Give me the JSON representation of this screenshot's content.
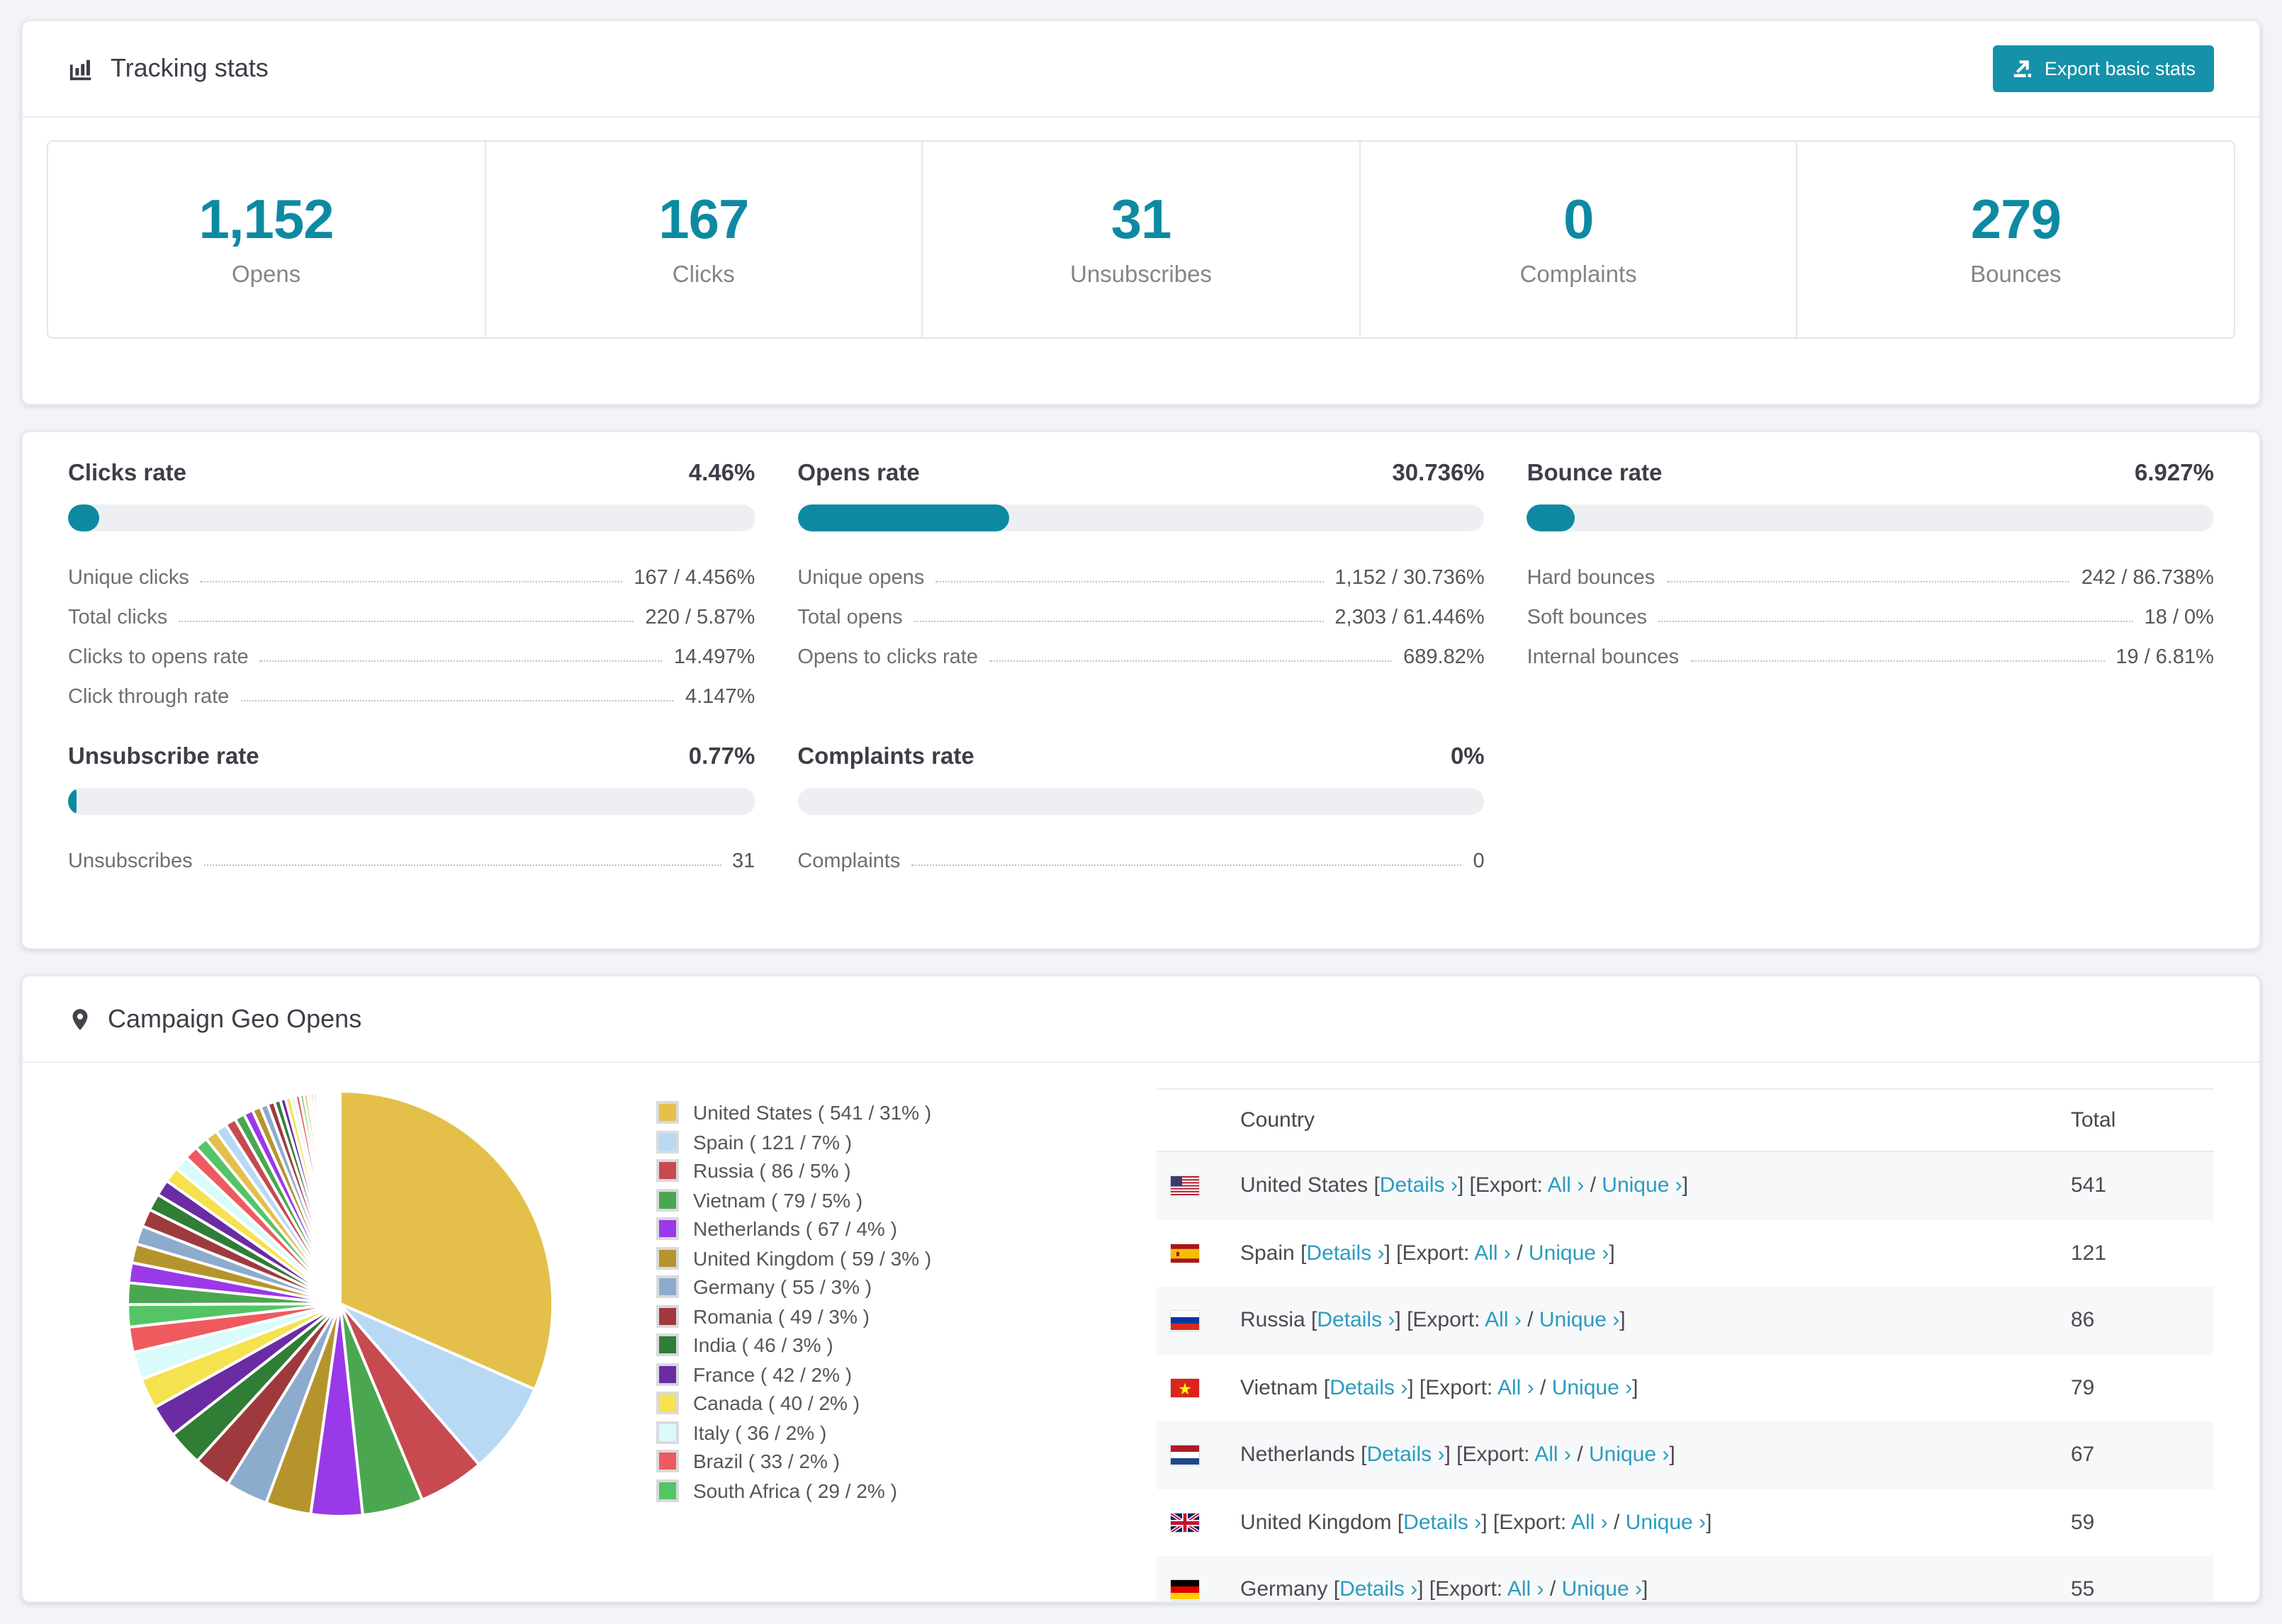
{
  "tracking": {
    "title": "Tracking stats",
    "export_button": "Export basic stats",
    "stats": [
      {
        "value": "1,152",
        "label": "Opens"
      },
      {
        "value": "167",
        "label": "Clicks"
      },
      {
        "value": "31",
        "label": "Unsubscribes"
      },
      {
        "value": "0",
        "label": "Complaints"
      },
      {
        "value": "279",
        "label": "Bounces"
      }
    ]
  },
  "rates": [
    {
      "title": "Clicks rate",
      "value": "4.46%",
      "percent": 4.46,
      "rows": [
        {
          "label": "Unique clicks",
          "value": "167 / 4.456%"
        },
        {
          "label": "Total clicks",
          "value": "220 / 5.87%"
        },
        {
          "label": "Clicks to opens rate",
          "value": "14.497%"
        },
        {
          "label": "Click through rate",
          "value": "4.147%"
        }
      ]
    },
    {
      "title": "Opens rate",
      "value": "30.736%",
      "percent": 30.736,
      "rows": [
        {
          "label": "Unique opens",
          "value": "1,152 / 30.736%"
        },
        {
          "label": "Total opens",
          "value": "2,303 / 61.446%"
        },
        {
          "label": "Opens to clicks rate",
          "value": "689.82%"
        }
      ]
    },
    {
      "title": "Bounce rate",
      "value": "6.927%",
      "percent": 6.927,
      "rows": [
        {
          "label": "Hard bounces",
          "value": "242 / 86.738%"
        },
        {
          "label": "Soft bounces",
          "value": "18 / 0%"
        },
        {
          "label": "Internal bounces",
          "value": "19 / 6.81%"
        }
      ]
    },
    {
      "title": "Unsubscribe rate",
      "value": "0.77%",
      "percent": 0.77,
      "rows": [
        {
          "label": "Unsubscribes",
          "value": "31"
        }
      ]
    },
    {
      "title": "Complaints rate",
      "value": "0%",
      "percent": 0,
      "rows": [
        {
          "label": "Complaints",
          "value": "0"
        }
      ]
    }
  ],
  "geo": {
    "title": "Campaign Geo Opens",
    "table": {
      "columns": [
        "Country",
        "Total"
      ],
      "link_labels": {
        "details": "Details ›",
        "export": "Export:",
        "all": "All ›",
        "unique": "Unique ›"
      },
      "rows": [
        {
          "country": "United States",
          "flag": "us",
          "total": "541"
        },
        {
          "country": "Spain",
          "flag": "es",
          "total": "121"
        },
        {
          "country": "Russia",
          "flag": "ru",
          "total": "86"
        },
        {
          "country": "Vietnam",
          "flag": "vn",
          "total": "79"
        },
        {
          "country": "Netherlands",
          "flag": "nl",
          "total": "67"
        },
        {
          "country": "United Kingdom",
          "flag": "gb",
          "total": "59"
        },
        {
          "country": "Germany",
          "flag": "de",
          "total": "55"
        }
      ]
    }
  },
  "chart_data": {
    "type": "pie",
    "title": "Campaign Geo Opens",
    "legend_position": "right",
    "labels": [
      "United States",
      "Spain",
      "Russia",
      "Vietnam",
      "Netherlands",
      "United Kingdom",
      "Germany",
      "Romania",
      "India",
      "France",
      "Canada",
      "Italy",
      "Brazil",
      "South Africa"
    ],
    "values": [
      541,
      121,
      86,
      79,
      67,
      59,
      55,
      49,
      46,
      42,
      40,
      36,
      33,
      29
    ],
    "percents": [
      31,
      7,
      5,
      5,
      4,
      3,
      3,
      3,
      3,
      2,
      2,
      2,
      2,
      2
    ],
    "others_values": [
      28,
      26,
      25,
      24,
      23,
      22,
      21,
      20,
      19,
      18,
      17,
      16,
      15,
      14,
      13,
      12,
      11,
      10,
      9,
      8,
      7,
      7,
      6,
      6,
      5,
      5,
      4,
      4,
      4,
      3,
      3,
      3,
      2,
      2,
      2,
      2,
      2,
      1,
      1,
      1,
      1,
      1,
      1,
      1,
      1,
      1,
      1,
      1
    ],
    "palette": [
      "#e4c04a",
      "#b7d9f4",
      "#c64a50",
      "#4aa750",
      "#9a39e8",
      "#b6942d",
      "#8dabcd",
      "#9e3a3e",
      "#307d36",
      "#6b2ba3",
      "#f6e14f",
      "#d9fbf9",
      "#ef5a5f",
      "#55c466"
    ]
  },
  "icons": {
    "tracking": "bar-chart-icon",
    "geo": "map-pin-icon",
    "export": "export-icon"
  },
  "theme": {
    "accent": "#0d8aa2",
    "button": "#1591a9",
    "link": "#2a9cc0"
  }
}
